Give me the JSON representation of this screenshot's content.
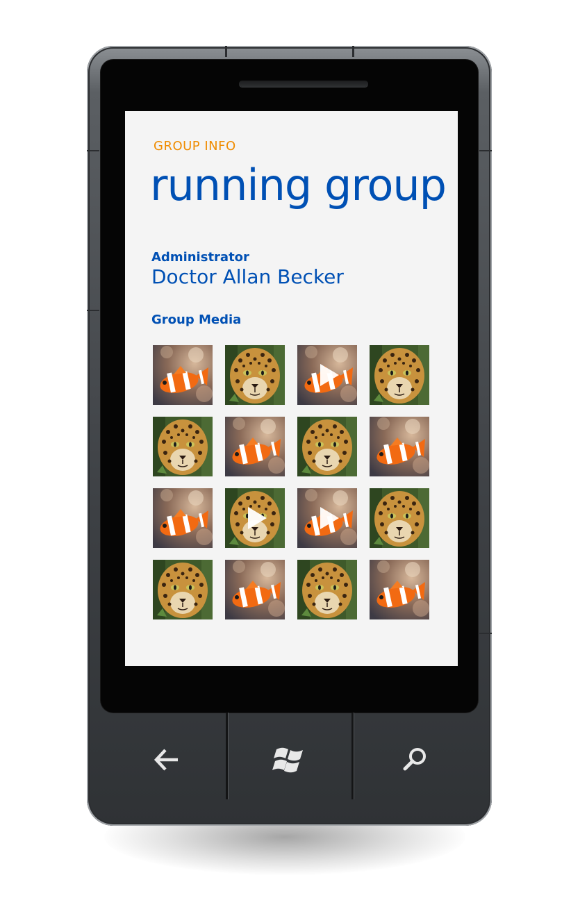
{
  "header": {
    "subtitle": "GROUP INFO",
    "title": "running group"
  },
  "admin": {
    "label": "Administrator",
    "value": "Doctor Allan Becker"
  },
  "media": {
    "label": "Group Media",
    "items": [
      {
        "subject": "clownfish",
        "video": false
      },
      {
        "subject": "jaguar",
        "video": false
      },
      {
        "subject": "clownfish",
        "video": true
      },
      {
        "subject": "jaguar",
        "video": false
      },
      {
        "subject": "jaguar",
        "video": false
      },
      {
        "subject": "clownfish",
        "video": false
      },
      {
        "subject": "jaguar",
        "video": false
      },
      {
        "subject": "clownfish",
        "video": false
      },
      {
        "subject": "clownfish",
        "video": false
      },
      {
        "subject": "jaguar",
        "video": true
      },
      {
        "subject": "clownfish",
        "video": true
      },
      {
        "subject": "jaguar",
        "video": false
      },
      {
        "subject": "jaguar",
        "video": false
      },
      {
        "subject": "clownfish",
        "video": false
      },
      {
        "subject": "jaguar",
        "video": false
      },
      {
        "subject": "clownfish",
        "video": false
      }
    ]
  },
  "hardware_buttons": [
    {
      "name": "back",
      "icon": "back-arrow-icon"
    },
    {
      "name": "start",
      "icon": "windows-logo-icon"
    },
    {
      "name": "search",
      "icon": "search-icon"
    }
  ],
  "colors": {
    "subtitle": "#f08c00",
    "accent": "#0050b4",
    "screen_background": "#f4f4f4",
    "button_icon": "#e8e8e8"
  }
}
